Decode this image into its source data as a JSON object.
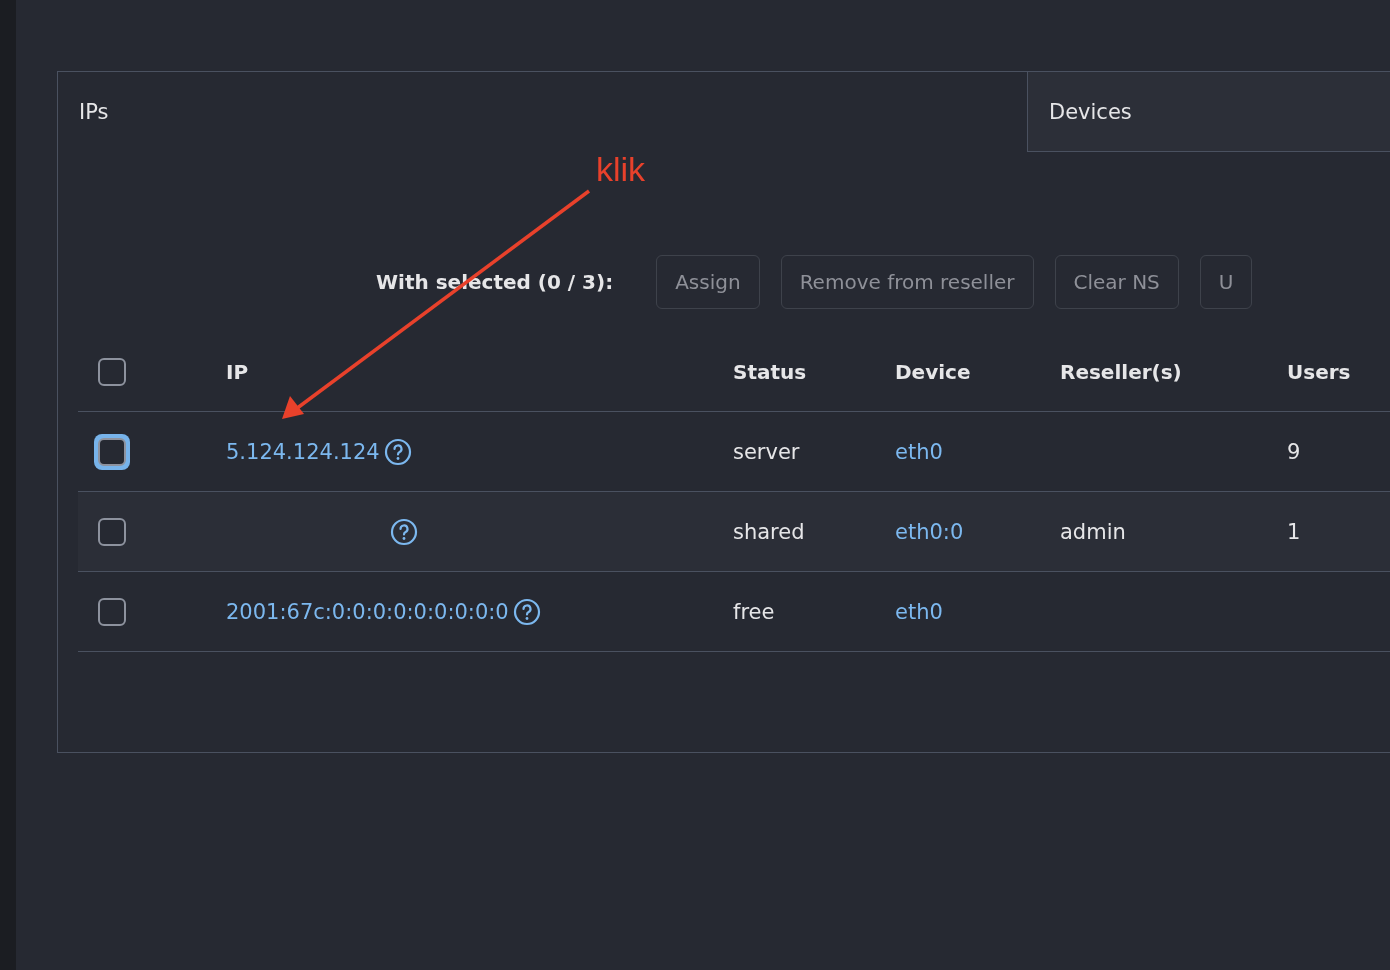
{
  "tabs": [
    {
      "label": "IPs",
      "selected": true
    },
    {
      "label": "Devices",
      "selected": false
    }
  ],
  "toolbar": {
    "label": "With selected (0 / 3):",
    "buttons": [
      "Assign",
      "Remove from reseller",
      "Clear NS",
      "U"
    ]
  },
  "table": {
    "select_all": {
      "checked": false
    },
    "columns": [
      "IP",
      "Status",
      "Device",
      "Reseller(s)",
      "Users"
    ],
    "rows": [
      {
        "selected": false,
        "focused": true,
        "ip": "5.124.124.124",
        "status": "server",
        "device": "eth0",
        "resellers": "",
        "users": "9"
      },
      {
        "selected": false,
        "focused": false,
        "ip": "",
        "status": "shared",
        "device": "eth0:0",
        "resellers": "admin",
        "users": "1"
      },
      {
        "selected": false,
        "focused": false,
        "ip": "2001:67c:0:0:0:0:0:0:0:0:0",
        "status": "free",
        "device": "eth0",
        "resellers": "",
        "users": ""
      }
    ]
  },
  "annotation": {
    "text": "klik"
  }
}
